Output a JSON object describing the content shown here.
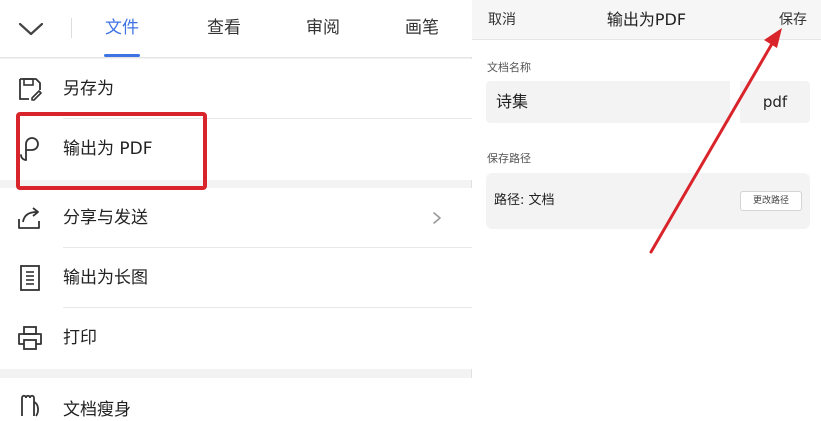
{
  "tabs": [
    {
      "label": "文件",
      "active": true
    },
    {
      "label": "查看",
      "active": false
    },
    {
      "label": "审阅",
      "active": false
    },
    {
      "label": "画笔",
      "active": false
    }
  ],
  "menu": {
    "save_as": {
      "label": "另存为",
      "icon": "save-as-icon"
    },
    "export_pdf": {
      "label": "输出为 PDF",
      "icon": "pdf-export-icon"
    },
    "share": {
      "label": "分享与发送",
      "icon": "share-icon"
    },
    "long_image": {
      "label": "输出为长图",
      "icon": "long-image-icon"
    },
    "print": {
      "label": "打印",
      "icon": "printer-icon"
    },
    "slim": {
      "label": "文档瘦身",
      "icon": "document-slim-icon"
    }
  },
  "dialog": {
    "cancel": "取消",
    "title": "输出为PDF",
    "save": "保存",
    "name_label": "文档名称",
    "name_value": "诗集",
    "extension": "pdf",
    "path_label": "保存路径",
    "path_value": "路径: 文档",
    "change_path": "更改路径"
  },
  "colors": {
    "accent": "#3f73e4",
    "annotation": "#d9242b"
  }
}
